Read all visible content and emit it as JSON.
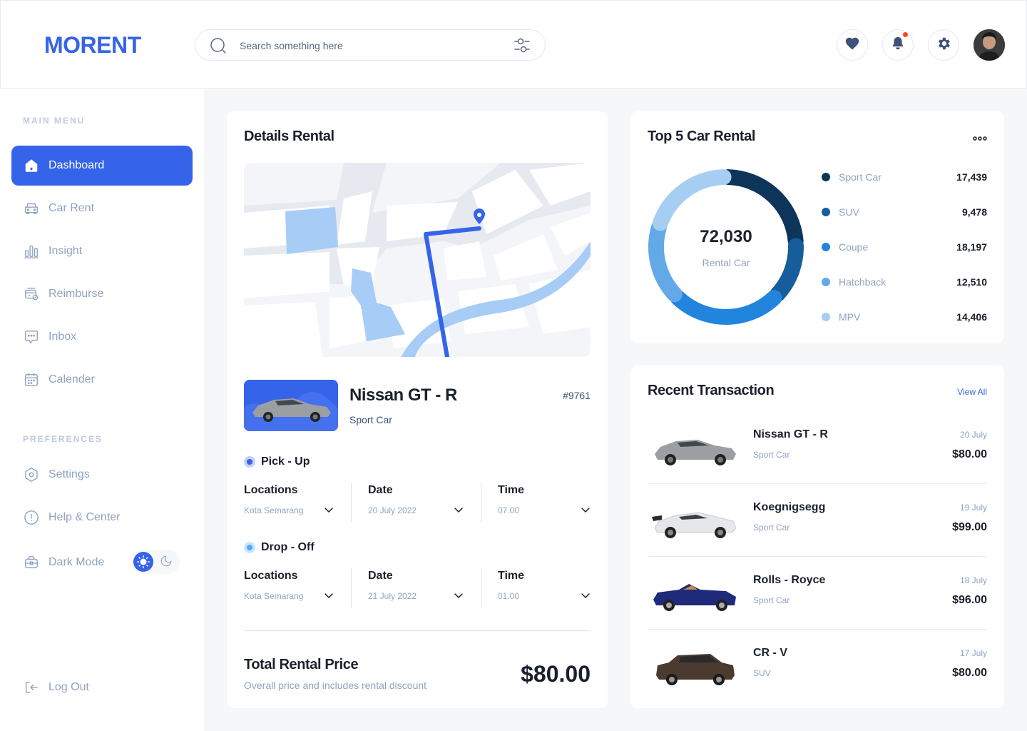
{
  "brand": {
    "logo": "MORENT"
  },
  "search": {
    "placeholder": "Search something here"
  },
  "header_icons": [
    "heart-icon",
    "bell-icon",
    "gear-icon"
  ],
  "sidebar": {
    "main_menu_title": "MAIN MENU",
    "items": [
      {
        "label": "Dashboard",
        "icon": "home-icon",
        "active": true
      },
      {
        "label": "Car Rent",
        "icon": "car-icon"
      },
      {
        "label": "Insight",
        "icon": "chart-bars-icon"
      },
      {
        "label": "Reimburse",
        "icon": "wallet-icon"
      },
      {
        "label": "Inbox",
        "icon": "message-icon"
      },
      {
        "label": "Calender",
        "icon": "calendar-icon"
      }
    ],
    "preferences_title": "PREFERENCES",
    "pref_items": [
      {
        "label": "Settings",
        "icon": "settings-icon"
      },
      {
        "label": "Help & Center",
        "icon": "info-icon"
      },
      {
        "label": "Dark Mode",
        "icon": "briefcase-icon"
      }
    ],
    "logout": "Log Out"
  },
  "details": {
    "title": "Details Rental",
    "car_name": "Nissan GT - R",
    "car_type": "Sport Car",
    "car_id": "#9761",
    "pickup": {
      "label": "Pick - Up",
      "locations_label": "Locations",
      "location": "Kota Semarang",
      "date_label": "Date",
      "date": "20 July 2022",
      "time_label": "Time",
      "time": "07.00"
    },
    "dropoff": {
      "label": "Drop - Off",
      "locations_label": "Locations",
      "location": "Kota Semarang",
      "date_label": "Date",
      "date": "21 July 2022",
      "time_label": "Time",
      "time": "01.00"
    },
    "total_title": "Total Rental Price",
    "total_sub": "Overall price and includes rental discount",
    "total_price": "$80.00"
  },
  "top5": {
    "title": "Top 5 Car Rental",
    "total": "72,030",
    "total_label": "Rental Car",
    "items": [
      {
        "name": "Sport Car",
        "value": "17,439",
        "color": "#0D3559"
      },
      {
        "name": "SUV",
        "value": "9,478",
        "color": "#175D9C"
      },
      {
        "name": "Coupe",
        "value": "18,197",
        "color": "#2185DE"
      },
      {
        "name": "Hatchback",
        "value": "12,510",
        "color": "#63A9E8"
      },
      {
        "name": "MPV",
        "value": "14,406",
        "color": "#A6CEF2"
      }
    ]
  },
  "recent": {
    "title": "Recent Transaction",
    "view_all": "View All",
    "items": [
      {
        "name": "Nissan GT - R",
        "type": "Sport Car",
        "date": "20 July",
        "price": "$80.00",
        "color": "#9b9ea3"
      },
      {
        "name": "Koegnigsegg",
        "type": "Sport Car",
        "date": "19 July",
        "price": "$99.00",
        "color": "#e8e9ec"
      },
      {
        "name": "Rolls - Royce",
        "type": "Sport Car",
        "date": "18 July",
        "price": "$96.00",
        "color": "#1f2a7a"
      },
      {
        "name": "CR - V",
        "type": "SUV",
        "date": "17 July",
        "price": "$80.00",
        "color": "#4a3a30"
      }
    ]
  },
  "colors": {
    "accent": "#3563E9",
    "notification": "#FF4423"
  }
}
